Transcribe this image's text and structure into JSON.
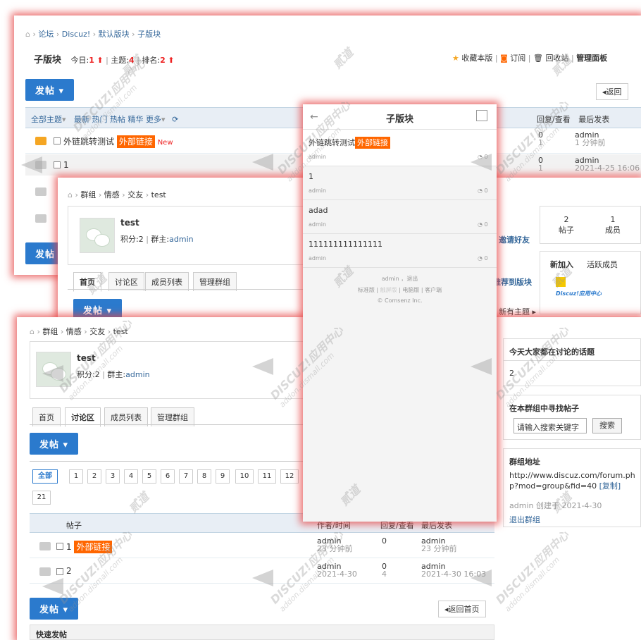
{
  "s1": {
    "breadcrumb": [
      "论坛",
      "Discuz!",
      "默认版块",
      "子版块"
    ],
    "board_title": "子版块",
    "stats": {
      "today_label": "今日:",
      "today": "1",
      "topics_label": "主题:",
      "topics": "4",
      "rank_label": "排名:",
      "rank": "2"
    },
    "actions": {
      "favorite": "收藏本版",
      "subscribe": "订阅",
      "recycle": "回收站",
      "manage": "管理面板"
    },
    "post_btn": "发帖",
    "back_btn": "返回",
    "filters": {
      "all": "全部主题",
      "latest": "最新",
      "hot": "热门",
      "hottest": "热帖",
      "digest": "精华",
      "more": "更多"
    },
    "col_replies": "回复/查看",
    "col_last": "最后发表",
    "threads": [
      {
        "title": "外链跳转测试",
        "tag": "外部链接",
        "new": "New",
        "replies": "0",
        "views": "1",
        "last_user": "admin",
        "last_time": "1 分钟前"
      },
      {
        "title": "1",
        "replies": "0",
        "views": "1",
        "last_user": "admin",
        "last_time": "2021-4-25 16:06"
      }
    ]
  },
  "s2": {
    "breadcrumb": [
      "群组",
      "情感",
      "交友",
      "test"
    ],
    "group_name": "test",
    "points_label": "积分:",
    "points": "2",
    "owner_label": "群主:",
    "owner": "admin",
    "tabs": [
      "首页",
      "讨论区",
      "成员列表",
      "管理群组"
    ],
    "post_btn": "发帖",
    "invite": "邀请好友",
    "recommend": "推荐到版块",
    "new_topic": "新有主题",
    "stat_posts": "2",
    "stat_posts_label": "帖子",
    "stat_members": "1",
    "stat_members_label": "成员",
    "new_join": "新加入",
    "active_members": "活跃成员",
    "logo_text": "Discuz!应用中心"
  },
  "s3": {
    "breadcrumb": [
      "群组",
      "情感",
      "交友",
      "test"
    ],
    "group_name": "test",
    "points_label": "积分:",
    "points": "2",
    "owner_label": "群主:",
    "owner": "admin",
    "tabs": [
      "首页",
      "讨论区",
      "成员列表",
      "管理群组"
    ],
    "post_btn": "发帖",
    "pages": [
      "全部",
      "1",
      "2",
      "3",
      "4",
      "5",
      "6",
      "7",
      "8",
      "9",
      "10",
      "11",
      "12"
    ],
    "page_extra": "21",
    "col_thread": "帖子",
    "col_author": "作者/时间",
    "col_replies": "回复/查看",
    "col_last": "最后发表",
    "threads": [
      {
        "title": "1",
        "tag": "外部链接",
        "author": "admin",
        "time": "23 分钟前",
        "replies": "0",
        "views": "",
        "last_user": "admin",
        "last_time": "23 分钟前"
      },
      {
        "title": "2",
        "author": "admin",
        "time": "2021-4-30",
        "replies": "0",
        "views": "4",
        "last_user": "admin",
        "last_time": "2021-4-30 16:03"
      }
    ],
    "back_home": "返回首页",
    "quick_post": "快速发帖",
    "side_hot_title": "今天大家都在讨论的话题",
    "side_hot_value": "2",
    "side_search_title": "在本群组中寻找帖子",
    "side_search_placeholder": "请输入搜索关键字",
    "side_search_btn": "搜索",
    "side_addr_title": "群组地址",
    "side_addr_url": "http://www.discuz.com/forum.php?mod=group&fid=40",
    "side_copy": "[复制]",
    "side_created": "admin 创建于 2021-4-30",
    "side_quit": "退出群组"
  },
  "mobile": {
    "title": "子版块",
    "items": [
      {
        "title": "外链跳转测试",
        "tag": "外部链接",
        "author": "admin",
        "count": "0"
      },
      {
        "title": "1",
        "author": "admin",
        "count": "0"
      },
      {
        "title": "adad",
        "author": "admin",
        "count": "0"
      },
      {
        "title": "111111111111111",
        "author": "admin",
        "count": "0"
      }
    ],
    "footer_user": "admin",
    "footer_logout": "退出",
    "footer_links": [
      "标准版",
      "触屏版",
      "电脑版",
      "客户端"
    ],
    "copyright": "© Comsenz Inc."
  },
  "watermark": {
    "brand": "DISCUZ!应用中心",
    "site": "addon.dismall.com",
    "author": "贰道"
  },
  "colors": {
    "accent": "#2b7acd",
    "tag": "#ff6600",
    "shadow": "#e64646"
  }
}
